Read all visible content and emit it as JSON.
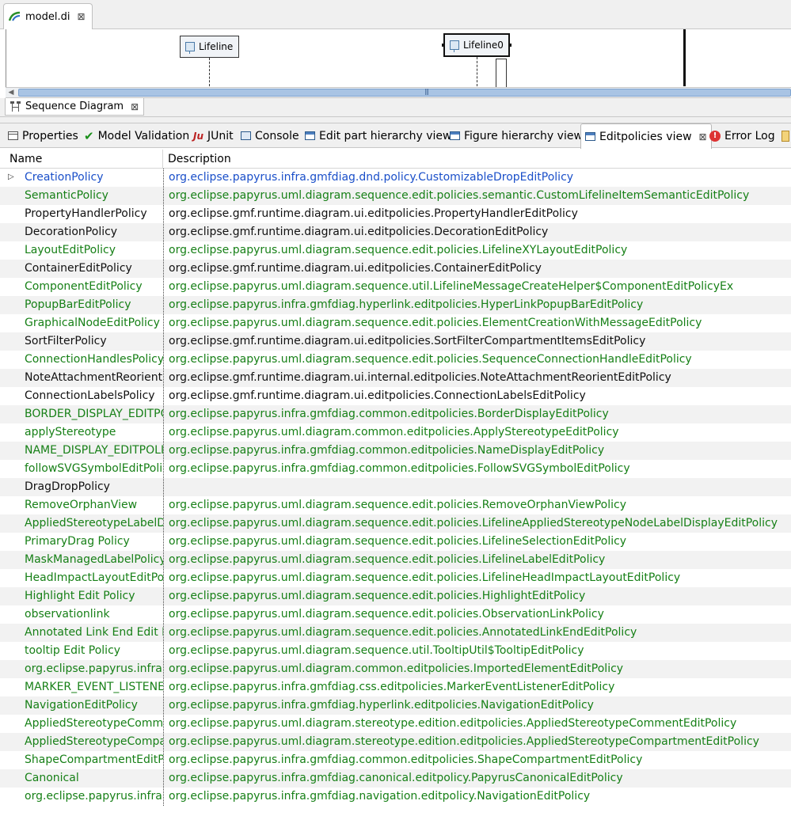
{
  "editor": {
    "tab_label": "model.di"
  },
  "diagram": {
    "lifeline_1": "Lifeline",
    "lifeline_2": "Lifeline0",
    "tab_label": "Sequence Diagram"
  },
  "views": {
    "tabs": [
      {
        "label": "Properties",
        "icon": "properties-icon"
      },
      {
        "label": "Model Validation",
        "icon": "check-icon"
      },
      {
        "label": "JUnit",
        "icon": "junit-icon"
      },
      {
        "label": "Console",
        "icon": "console-icon"
      },
      {
        "label": "Edit part hierarchy view",
        "icon": "view-icon"
      },
      {
        "label": "Figure hierarchy view",
        "icon": "view-icon"
      },
      {
        "label": "Editpolicies view",
        "icon": "view-icon",
        "active": true
      },
      {
        "label": "Error Log",
        "icon": "error-log-icon"
      }
    ]
  },
  "table": {
    "columns": [
      "Name",
      "Description"
    ],
    "rows": [
      {
        "name": "CreationPolicy",
        "desc": "org.eclipse.papyrus.infra.gmfdiag.dnd.policy.CustomizableDropEditPolicy",
        "color": "blue",
        "expandable": true
      },
      {
        "name": "SemanticPolicy",
        "desc": "org.eclipse.papyrus.uml.diagram.sequence.edit.policies.semantic.CustomLifelineItemSemanticEditPolicy",
        "color": "green"
      },
      {
        "name": "PropertyHandlerPolicy",
        "desc": "org.eclipse.gmf.runtime.diagram.ui.editpolicies.PropertyHandlerEditPolicy",
        "color": "black"
      },
      {
        "name": "DecorationPolicy",
        "desc": "org.eclipse.gmf.runtime.diagram.ui.editpolicies.DecorationEditPolicy",
        "color": "black"
      },
      {
        "name": "LayoutEditPolicy",
        "desc": "org.eclipse.papyrus.uml.diagram.sequence.edit.policies.LifelineXYLayoutEditPolicy",
        "color": "green"
      },
      {
        "name": "ContainerEditPolicy",
        "desc": "org.eclipse.gmf.runtime.diagram.ui.editpolicies.ContainerEditPolicy",
        "color": "black"
      },
      {
        "name": "ComponentEditPolicy",
        "desc": "org.eclipse.papyrus.uml.diagram.sequence.util.LifelineMessageCreateHelper$ComponentEditPolicyEx",
        "color": "green"
      },
      {
        "name": "PopupBarEditPolicy",
        "desc": "org.eclipse.papyrus.infra.gmfdiag.hyperlink.editpolicies.HyperLinkPopupBarEditPolicy",
        "color": "green"
      },
      {
        "name": "GraphicalNodeEditPolicy",
        "desc": "org.eclipse.papyrus.uml.diagram.sequence.edit.policies.ElementCreationWithMessageEditPolicy",
        "color": "green"
      },
      {
        "name": "SortFilterPolicy",
        "desc": "org.eclipse.gmf.runtime.diagram.ui.editpolicies.SortFilterCompartmentItemsEditPolicy",
        "color": "black"
      },
      {
        "name": "ConnectionHandlesPolicy",
        "desc": "org.eclipse.papyrus.uml.diagram.sequence.edit.policies.SequenceConnectionHandleEditPolicy",
        "color": "green"
      },
      {
        "name": "NoteAttachmentReorient",
        "desc": "org.eclipse.gmf.runtime.diagram.ui.internal.editpolicies.NoteAttachmentReorientEditPolicy",
        "color": "black"
      },
      {
        "name": "ConnectionLabelsPolicy",
        "desc": "org.eclipse.gmf.runtime.diagram.ui.editpolicies.ConnectionLabelsEditPolicy",
        "color": "black"
      },
      {
        "name": "BORDER_DISPLAY_EDITPOLICY",
        "desc": "org.eclipse.papyrus.infra.gmfdiag.common.editpolicies.BorderDisplayEditPolicy",
        "color": "green"
      },
      {
        "name": "applyStereotype",
        "desc": "org.eclipse.papyrus.uml.diagram.common.editpolicies.ApplyStereotypeEditPolicy",
        "color": "green"
      },
      {
        "name": "NAME_DISPLAY_EDITPOLICY",
        "desc": "org.eclipse.papyrus.infra.gmfdiag.common.editpolicies.NameDisplayEditPolicy",
        "color": "green"
      },
      {
        "name": "followSVGSymbolEditPolicy",
        "desc": "org.eclipse.papyrus.infra.gmfdiag.common.editpolicies.FollowSVGSymbolEditPolicy",
        "color": "green"
      },
      {
        "name": "DragDropPolicy",
        "desc": "",
        "color": "black"
      },
      {
        "name": "RemoveOrphanView",
        "desc": "org.eclipse.papyrus.uml.diagram.sequence.edit.policies.RemoveOrphanViewPolicy",
        "color": "green"
      },
      {
        "name": "AppliedStereotypeLabelDisplay",
        "desc": "org.eclipse.papyrus.uml.diagram.sequence.edit.policies.LifelineAppliedStereotypeNodeLabelDisplayEditPolicy",
        "color": "green"
      },
      {
        "name": "PrimaryDrag Policy",
        "desc": "org.eclipse.papyrus.uml.diagram.sequence.edit.policies.LifelineSelectionEditPolicy",
        "color": "green"
      },
      {
        "name": "MaskManagedLabelPolicy",
        "desc": "org.eclipse.papyrus.uml.diagram.sequence.edit.policies.LifelineLabelEditPolicy",
        "color": "green"
      },
      {
        "name": "HeadImpactLayoutEditPolicy",
        "desc": "org.eclipse.papyrus.uml.diagram.sequence.edit.policies.LifelineHeadImpactLayoutEditPolicy",
        "color": "green"
      },
      {
        "name": "Highlight Edit Policy",
        "desc": "org.eclipse.papyrus.uml.diagram.sequence.edit.policies.HighlightEditPolicy",
        "color": "green"
      },
      {
        "name": "observationlink",
        "desc": "org.eclipse.papyrus.uml.diagram.sequence.edit.policies.ObservationLinkPolicy",
        "color": "green"
      },
      {
        "name": "Annotated Link End Edit Policy",
        "desc": "org.eclipse.papyrus.uml.diagram.sequence.edit.policies.AnnotatedLinkEndEditPolicy",
        "color": "green"
      },
      {
        "name": "tooltip Edit Policy",
        "desc": "org.eclipse.papyrus.uml.diagram.sequence.util.TooltipUtil$TooltipEditPolicy",
        "color": "green"
      },
      {
        "name": "org.eclipse.papyrus.infra.gmfdiag",
        "desc": "org.eclipse.papyrus.uml.diagram.common.editpolicies.ImportedElementEditPolicy",
        "color": "green"
      },
      {
        "name": "MARKER_EVENT_LISTENER",
        "desc": "org.eclipse.papyrus.infra.gmfdiag.css.editpolicies.MarkerEventListenerEditPolicy",
        "color": "green"
      },
      {
        "name": "NavigationEditPolicy",
        "desc": "org.eclipse.papyrus.infra.gmfdiag.hyperlink.editpolicies.NavigationEditPolicy",
        "color": "green"
      },
      {
        "name": "AppliedStereotypeCommentEditPolicy",
        "desc": "org.eclipse.papyrus.uml.diagram.stereotype.edition.editpolicies.AppliedStereotypeCommentEditPolicy",
        "color": "green"
      },
      {
        "name": "AppliedStereotypeCompartmentEditPolicy",
        "desc": "org.eclipse.papyrus.uml.diagram.stereotype.edition.editpolicies.AppliedStereotypeCompartmentEditPolicy",
        "color": "green"
      },
      {
        "name": "ShapeCompartmentEditPolicy",
        "desc": "org.eclipse.papyrus.infra.gmfdiag.common.editpolicies.ShapeCompartmentEditPolicy",
        "color": "green"
      },
      {
        "name": "Canonical",
        "desc": "org.eclipse.papyrus.infra.gmfdiag.canonical.editpolicy.PapyrusCanonicalEditPolicy",
        "color": "green"
      },
      {
        "name": "org.eclipse.papyrus.infra.gmfdiag",
        "desc": "org.eclipse.papyrus.infra.gmfdiag.navigation.editpolicy.NavigationEditPolicy",
        "color": "green"
      }
    ]
  }
}
